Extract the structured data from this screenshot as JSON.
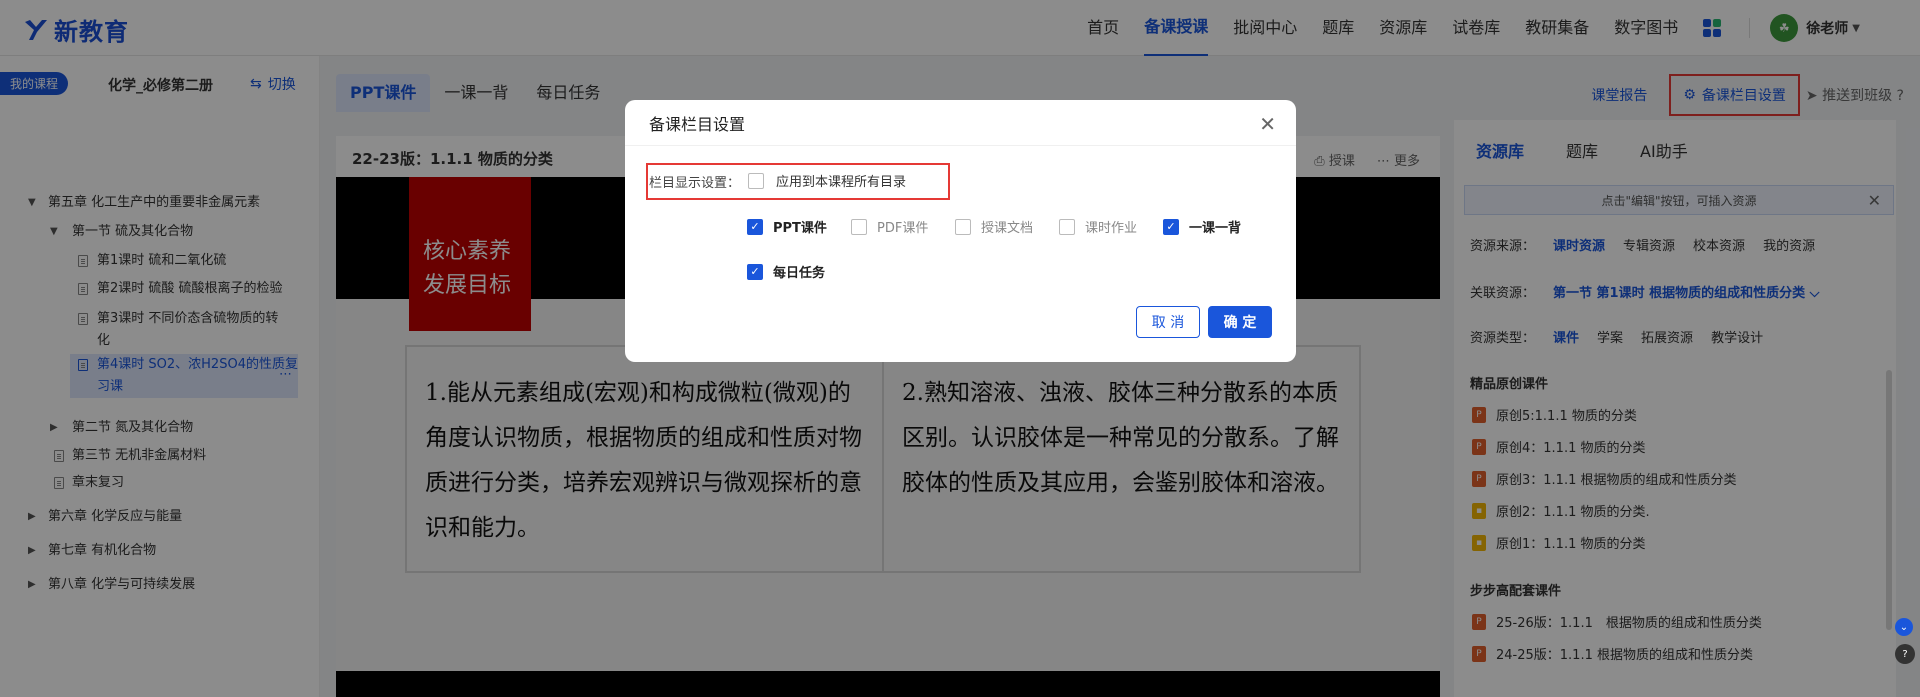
{
  "header": {
    "logo_text": "新教育",
    "nav": [
      "首页",
      "备课授课",
      "批阅中心",
      "题库",
      "资源库",
      "试卷库",
      "教研集备",
      "数字图书"
    ],
    "active_index": 1,
    "user": "徐老师"
  },
  "sidebar": {
    "my_course": "我的课程",
    "course": "化学_必修第二册",
    "switch": "切换",
    "tree": [
      {
        "label": "第五章 化工生产中的重要非金属元素",
        "level": 0,
        "expanded": true
      },
      {
        "label": "第一节 硫及其化合物",
        "level": 1,
        "expanded": true
      },
      {
        "label": "第1课时 硫和二氧化硫",
        "level": 2
      },
      {
        "label": "第2课时 硫酸 硫酸根离子的检验",
        "level": 2
      },
      {
        "label": "第3课时 不同价态含硫物质的转化",
        "level": 2
      },
      {
        "label": "第4课时 SO2、浓H2SO4的性质复习课",
        "level": 2,
        "selected": true
      },
      {
        "label": "第二节 氮及其化合物",
        "level": 1
      },
      {
        "label": "第三节 无机非金属材料",
        "level": 1
      },
      {
        "label": "章末复习",
        "level": 1
      },
      {
        "label": "第六章 化学反应与能量",
        "level": 0
      },
      {
        "label": "第七章 有机化合物",
        "level": 0
      },
      {
        "label": "第八章 化学与可持续发展",
        "level": 0
      }
    ]
  },
  "main": {
    "tabs": [
      "PPT课件",
      "一课一背",
      "每日任务"
    ],
    "title": "22-23版：1.1.1 物质的分类",
    "actions": [
      "授课",
      "更多"
    ],
    "slide": {
      "red_label_1": "核心素养",
      "red_label_2": "发展目标",
      "cell1": "1.能从元素组成(宏观)和构成微粒(微观)的角度认识物质，根据物质的组成和性质对物质进行分类，培养宏观辨识与微观探析的意识和能力。",
      "cell2": "2.熟知溶液、浊液、胶体三种分散系的本质区别。认识胶体是一种常见的分散系。了解胶体的性质及其应用，会鉴别胶体和溶液。"
    }
  },
  "topright": {
    "report": "课堂报告",
    "settings": "备课栏目设置",
    "push": "推送到班级"
  },
  "rpanel": {
    "tabs": [
      "资源库",
      "题库",
      "AI助手"
    ],
    "hint": "点击\"编辑\"按钮，可插入资源",
    "source_label": "资源来源：",
    "sources": [
      "课时资源",
      "专辑资源",
      "校本资源",
      "我的资源"
    ],
    "related_label": "关联资源：",
    "related": "第一节 第1课时 根据物质的组成和性质分类",
    "type_label": "资源类型：",
    "types": [
      "课件",
      "学案",
      "拓展资源",
      "教学设计"
    ],
    "section1": "精品原创课件",
    "items1": [
      "原创5:1.1.1 物质的分类",
      "原创4：1.1.1 物质的分类",
      "原创3：1.1.1 根据物质的组成和性质分类",
      "原创2：1.1.1 物质的分类.",
      "原创1：1.1.1 物质的分类"
    ],
    "section2": "步步高配套课件",
    "items2": [
      "25-26版：1.1.1　根据物质的组成和性质分类",
      "24-25版：1.1.1 根据物质的组成和性质分类"
    ]
  },
  "modal": {
    "title": "备课栏目设置",
    "display_label": "栏目显示设置：",
    "apply_all": "应用到本课程所有目录",
    "options": [
      {
        "label": "PPT课件",
        "checked": true
      },
      {
        "label": "PDF课件",
        "checked": false
      },
      {
        "label": "授课文档",
        "checked": false
      },
      {
        "label": "课时作业",
        "checked": false
      },
      {
        "label": "一课一背",
        "checked": true
      },
      {
        "label": "每日任务",
        "checked": true
      }
    ],
    "cancel": "取 消",
    "ok": "确 定"
  }
}
